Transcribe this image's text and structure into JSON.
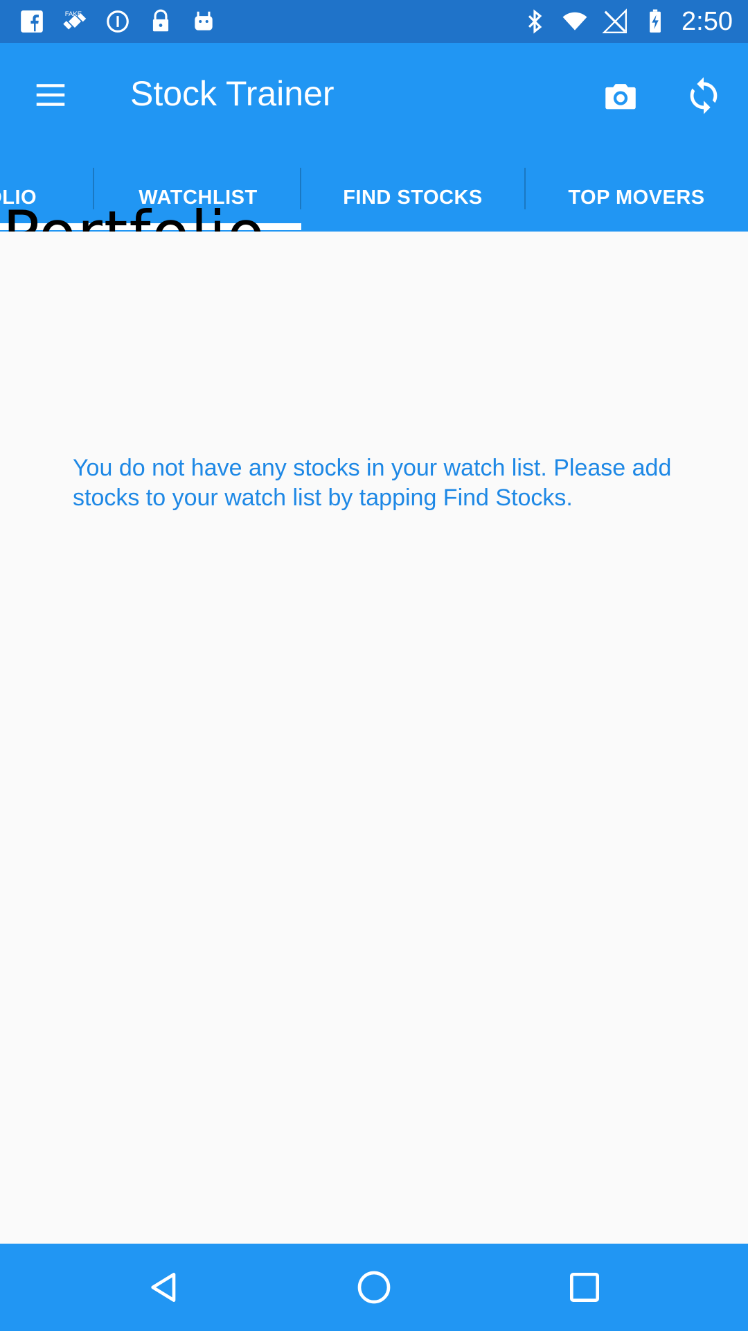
{
  "status_bar": {
    "time": "2:50",
    "left_icons": [
      "facebook-icon",
      "satellite-icon",
      "info-icon",
      "lock-icon",
      "android-icon"
    ],
    "right_icons": [
      "bluetooth-icon",
      "wifi-icon",
      "signal-icon",
      "battery-icon"
    ]
  },
  "app_bar": {
    "title": "Stock Trainer",
    "menu_icon": "menu-icon",
    "camera_icon": "camera-icon",
    "refresh_icon": "refresh-icon"
  },
  "tabs": {
    "items": [
      {
        "label": "PORTFOLIO",
        "visible_label": "FOLIO"
      },
      {
        "label": "WATCHLIST"
      },
      {
        "label": "FIND STOCKS"
      },
      {
        "label": "TOP MOVERS"
      }
    ],
    "selected_index": 1
  },
  "overlay": {
    "text": "Portfolio"
  },
  "content": {
    "empty_message": "You do not have any stocks in your watch list. Please add stocks to your watch list by tapping Find Stocks."
  },
  "colors": {
    "status_bar": "#1f73c9",
    "app_bar": "#2196f3",
    "accent_text": "#1e88e5",
    "background": "#fafafa"
  },
  "nav_bar": {
    "icons": [
      "back-icon",
      "home-icon",
      "recent-apps-icon"
    ]
  }
}
